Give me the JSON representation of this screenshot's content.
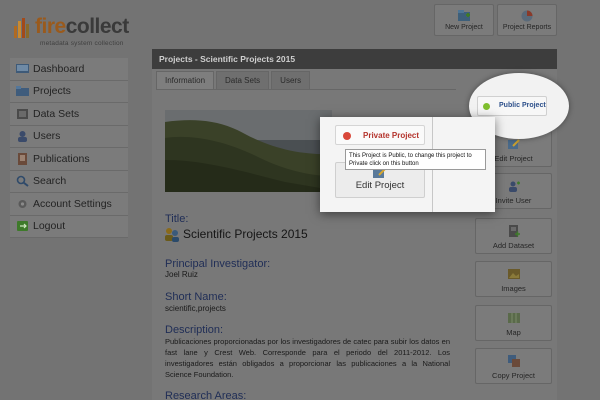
{
  "logo": {
    "word_fire": "fire",
    "word_collect": "collect",
    "tagline": "metadata system collection"
  },
  "top_buttons": [
    {
      "label": "New Project",
      "icon": "new-project-icon"
    },
    {
      "label": "Project Reports",
      "icon": "project-reports-icon"
    }
  ],
  "sidebar": {
    "items": [
      {
        "label": "Dashboard",
        "icon": "dashboard-icon"
      },
      {
        "label": "Projects",
        "icon": "folder-icon"
      },
      {
        "label": "Data Sets",
        "icon": "datasets-icon"
      },
      {
        "label": "Users",
        "icon": "users-icon"
      },
      {
        "label": "Publications",
        "icon": "publications-icon"
      },
      {
        "label": "Search",
        "icon": "search-icon"
      },
      {
        "label": "Account Settings",
        "icon": "settings-icon"
      },
      {
        "label": "Logout",
        "icon": "logout-icon"
      }
    ]
  },
  "panel": {
    "header": "Projects - Scientific Projects 2015",
    "tabs": [
      {
        "label": "Information",
        "active": true
      },
      {
        "label": "Data Sets",
        "active": false
      },
      {
        "label": "Users",
        "active": false
      }
    ]
  },
  "info": {
    "title_label": "Title:",
    "title_value": "Scientific Projects 2015",
    "pi_label": "Principal Investigator:",
    "pi_value": "Joel Ruiz",
    "short_label": "Short Name:",
    "short_value": "scientific,projects",
    "desc_label": "Description:",
    "desc_value": "Publicaciones proporcionadas por los investigadores de catec para subir los datos en fast lane y Crest Web. Corresponde para el periodo del 2011-2012. Los investigadores están obligados a proporcionar las publicaciones a la National Science Foundation.",
    "research_label": "Research Areas:"
  },
  "right_buttons": [
    {
      "label": "Edit Project",
      "icon": "edit-icon"
    },
    {
      "label": "Invite User",
      "icon": "invite-user-icon"
    },
    {
      "label": "Add Dataset",
      "icon": "add-dataset-icon"
    },
    {
      "label": "Images",
      "icon": "images-icon"
    },
    {
      "label": "Map",
      "icon": "map-icon"
    },
    {
      "label": "Copy Project",
      "icon": "copy-icon"
    }
  ],
  "status": {
    "public_label": "Public Project",
    "public_color": "#7fbf2e",
    "private_label": "Private Project",
    "private_color": "#d9483a",
    "tooltip": "This Project is Public, to change this project to Private click on this button",
    "edit_label": "Edit Project"
  }
}
